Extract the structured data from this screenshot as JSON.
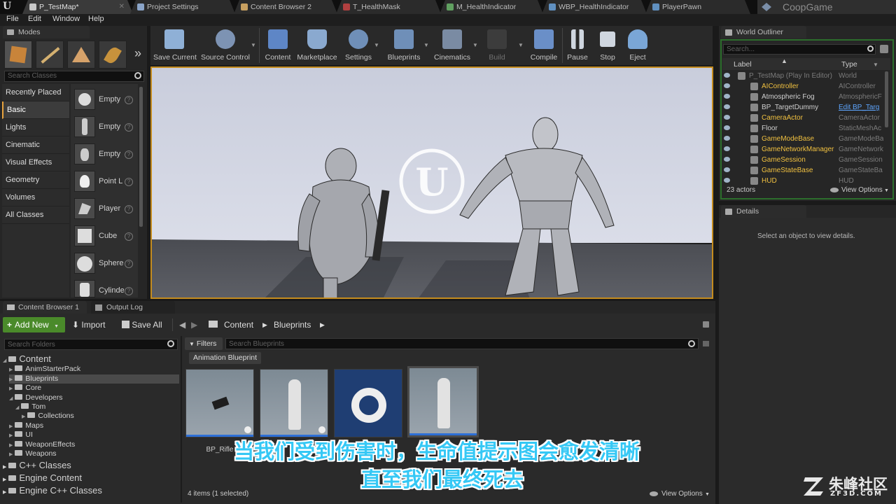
{
  "window": {
    "tabs": [
      {
        "label": "P_TestMap*",
        "icon_color": "#c8c8c8"
      },
      {
        "label": "Project Settings",
        "icon_color": "#8aa4c8"
      },
      {
        "label": "Content Browser 2",
        "icon_color": "#c8a060"
      },
      {
        "label": "T_HealthMask",
        "icon_color": "#b04040"
      },
      {
        "label": "M_HealthIndicator",
        "icon_color": "#60a060"
      },
      {
        "label": "WBP_HealthIndicator",
        "icon_color": "#6090c0"
      },
      {
        "label": "PlayerPawn",
        "icon_color": "#6090c0"
      }
    ],
    "close_glyph": "✕",
    "project_name": "CoopGame"
  },
  "menu": [
    "File",
    "Edit",
    "Window",
    "Help"
  ],
  "modes": {
    "tab_label": "Modes",
    "search_placeholder": "Search Classes",
    "categories": [
      "Recently Placed",
      "Basic",
      "Lights",
      "Cinematic",
      "Visual Effects",
      "Geometry",
      "Volumes",
      "All Classes"
    ],
    "items": [
      "Empty",
      "Empty",
      "Empty",
      "Point L",
      "Player",
      "Cube",
      "Sphere",
      "Cylinde"
    ],
    "more_glyph": "»"
  },
  "toolbar": {
    "buttons": [
      {
        "label": "Save Current",
        "color": "#8fb0d6"
      },
      {
        "label": "Source Control",
        "color": "#7d93b3"
      },
      {
        "label": "Content",
        "color": "#5e86c6"
      },
      {
        "label": "Marketplace",
        "color": "#8aa9cf"
      },
      {
        "label": "Settings",
        "color": "#6f8fb8"
      },
      {
        "label": "Blueprints",
        "color": "#6f8fb8"
      },
      {
        "label": "Cinematics",
        "color": "#7a8ba3"
      },
      {
        "label": "Build",
        "color": "#555555"
      },
      {
        "label": "Compile",
        "color": "#6a8fc8"
      },
      {
        "label": "Pause",
        "color": "#cfd6df"
      },
      {
        "label": "Stop",
        "color": "#cfd6df"
      },
      {
        "label": "Eject",
        "color": "#7aa6d6"
      }
    ]
  },
  "outliner": {
    "tab_label": "World Outliner",
    "search_placeholder": "Search...",
    "col_label": "Label",
    "col_type": "Type",
    "rows": [
      {
        "label": "P_TestMap (Play In Editor)",
        "type": "World",
        "label_color": "#7b7b7b"
      },
      {
        "label": "AIController",
        "type": "AIController",
        "label_color": "#f0c040"
      },
      {
        "label": "Atmospheric Fog",
        "type": "AtmosphericF",
        "label_color": "#d0d0d0"
      },
      {
        "label": "BP_TargetDummy",
        "type": "Edit BP_Targ",
        "label_color": "#d0d0d0",
        "type_link": true
      },
      {
        "label": "CameraActor",
        "type": "CameraActor",
        "label_color": "#f0c040"
      },
      {
        "label": "Floor",
        "type": "StaticMeshAc",
        "label_color": "#d0d0d0"
      },
      {
        "label": "GameModeBase",
        "type": "GameModeBa",
        "label_color": "#f0c040"
      },
      {
        "label": "GameNetworkManager",
        "type": "GameNetwork",
        "label_color": "#f0c040"
      },
      {
        "label": "GameSession",
        "type": "GameSession",
        "label_color": "#f0c040"
      },
      {
        "label": "GameStateBase",
        "type": "GameStateBa",
        "label_color": "#f0c040"
      },
      {
        "label": "HUD",
        "type": "HUD",
        "label_color": "#f0c040"
      }
    ],
    "count": "23 actors",
    "view_options": "View Options"
  },
  "details": {
    "tab_label": "Details",
    "empty_text": "Select an object to view details."
  },
  "content_browser": {
    "tab_label": "Content Browser 1",
    "output_tab": "Output Log",
    "add_new": "Add New",
    "import": "Import",
    "save_all": "Save All",
    "breadcrumb": [
      "Content",
      "Blueprints"
    ],
    "folder_search": "Search Folders",
    "asset_search": "Search Blueprints",
    "filters": "Filters",
    "filter_chip": "Animation Blueprint",
    "folders": [
      {
        "label": "Content",
        "depth": 0
      },
      {
        "label": "AnimStarterPack",
        "depth": 1
      },
      {
        "label": "Blueprints",
        "depth": 1,
        "selected": true
      },
      {
        "label": "Core",
        "depth": 1
      },
      {
        "label": "Developers",
        "depth": 1
      },
      {
        "label": "Tom",
        "depth": 2
      },
      {
        "label": "Collections",
        "depth": 3
      },
      {
        "label": "Maps",
        "depth": 1
      },
      {
        "label": "UI",
        "depth": 1
      },
      {
        "label": "WeaponEffects",
        "depth": 1
      },
      {
        "label": "Weapons",
        "depth": 1
      }
    ],
    "roots": [
      "C++ Classes",
      "Engine Content",
      "Engine C++ Classes"
    ],
    "assets": [
      {
        "label": "BP_Rifle"
      },
      {
        "label": ""
      },
      {
        "label": ""
      },
      {
        "label": ""
      }
    ],
    "status": "4 items (1 selected)",
    "view_options": "View Options"
  },
  "subtitles": [
    "当我们受到伤害时，生命值提示图会愈发清晰",
    "直至我们最终死去"
  ],
  "watermark": {
    "brand": "朱峰社区",
    "url": "ZF3D.COM"
  }
}
